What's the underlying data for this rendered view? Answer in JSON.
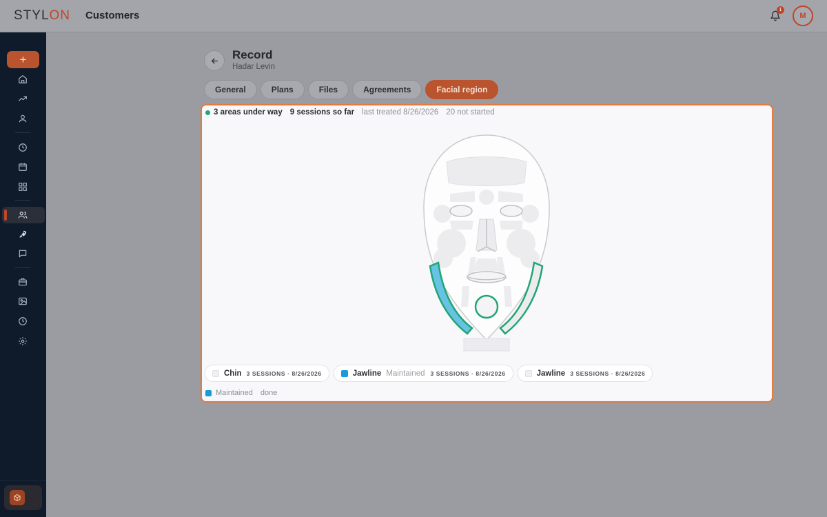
{
  "app": {
    "logo_main": "STYL",
    "logo_accent": "ON",
    "page_title": "Customers",
    "notification_count": "1",
    "user_initial": "M"
  },
  "sidebar": {
    "add_label": "+",
    "icons": [
      "home-icon",
      "trending-icon",
      "user-icon",
      "clock-icon",
      "calendar-icon",
      "grid-icon",
      "users-icon",
      "rocket-icon",
      "chat-icon",
      "briefcase-icon",
      "image-icon",
      "history-icon",
      "gear-icon"
    ],
    "active_item": "users-icon"
  },
  "record": {
    "title": "Record",
    "subtitle": "Hadar Levin",
    "tabs": [
      {
        "label": "General"
      },
      {
        "label": "Plans"
      },
      {
        "label": "Files"
      },
      {
        "label": "Agreements"
      },
      {
        "label": "Facial region"
      }
    ],
    "active_tab": "Facial region"
  },
  "summary": {
    "areas": "3 areas under way",
    "sessions": "9 sessions so far",
    "last_treated": "last treated 8/26/2026",
    "not_started": "20 not started"
  },
  "regions": [
    {
      "name": "Chin",
      "state": "",
      "meta": "3 SESSIONS · 8/26/2026",
      "marker": "empty"
    },
    {
      "name": "Jawline",
      "state": "Maintained",
      "meta": "3 SESSIONS · 8/26/2026",
      "marker": "blue"
    },
    {
      "name": "Jawline",
      "state": "",
      "meta": "3 SESSIONS · 8/26/2026",
      "marker": "empty"
    }
  ],
  "legend": {
    "label": "Maintained",
    "state": "done"
  },
  "colors": {
    "accent": "#c0452a",
    "highlight_green": "#1fa673",
    "maintained_blue": "#1a9ad8"
  }
}
